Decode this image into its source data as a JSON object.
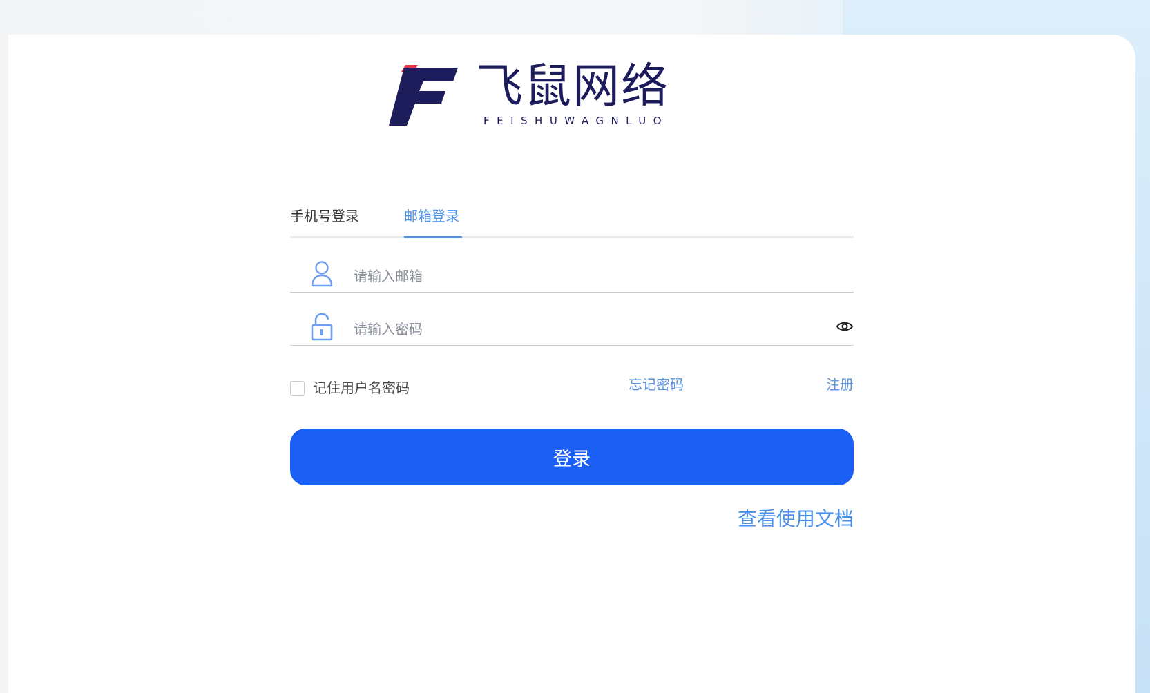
{
  "logo": {
    "name_cn": "飞鼠网络",
    "name_en": "FEISHUWAGNLUO",
    "icon": "brand-f-logo"
  },
  "tabs": [
    {
      "label": "手机号登录",
      "active": false
    },
    {
      "label": "邮箱登录",
      "active": true
    }
  ],
  "fields": {
    "email": {
      "placeholder": "请输入邮箱",
      "value": "",
      "icon": "user-icon"
    },
    "password": {
      "placeholder": "请输入密码",
      "value": "",
      "icon": "unlock-icon",
      "toggle_icon": "eye-icon"
    }
  },
  "options": {
    "remember_label": "记住用户名密码",
    "remember_checked": false,
    "forgot_label": "忘记密码",
    "register_label": "注册"
  },
  "login_button": "登录",
  "docs_link": "查看使用文档",
  "colors": {
    "accent": "#4a90e8",
    "button": "#1b5ff5",
    "brand_navy": "#1e1d5c",
    "brand_red": "#e8334a"
  }
}
